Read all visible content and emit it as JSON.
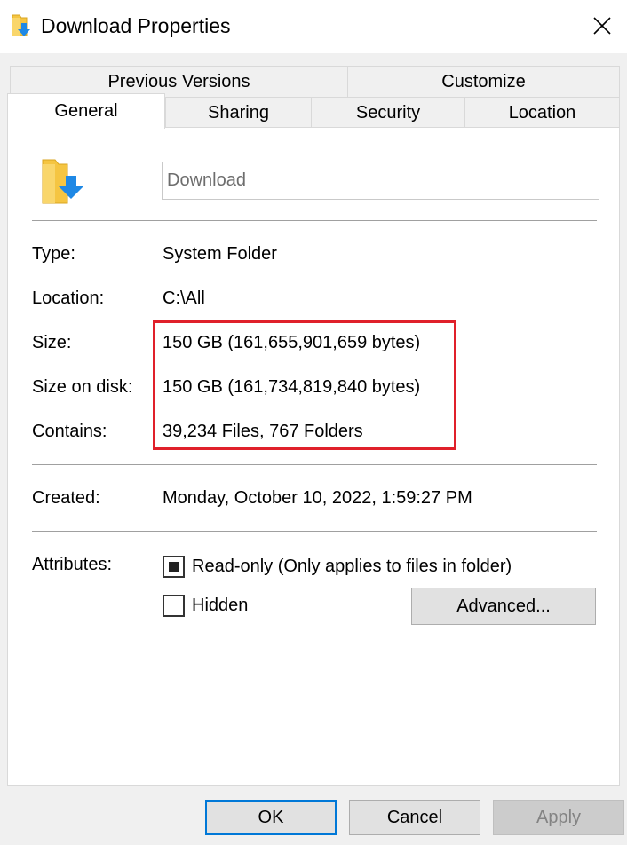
{
  "window": {
    "title": "Download Properties"
  },
  "tabs": {
    "row1": [
      "Previous Versions",
      "Customize"
    ],
    "row2": [
      "General",
      "Sharing",
      "Security",
      "Location"
    ]
  },
  "general": {
    "folder_name": "Download",
    "rows": [
      {
        "label": "Type:",
        "value": "System Folder"
      },
      {
        "label": "Location:",
        "value": "C:\\All"
      },
      {
        "label": "Size:",
        "value": "150 GB (161,655,901,659 bytes)"
      },
      {
        "label": "Size on disk:",
        "value": "150 GB (161,734,819,840 bytes)"
      },
      {
        "label": "Contains:",
        "value": "39,234 Files, 767 Folders"
      }
    ],
    "created": {
      "label": "Created:",
      "value": "Monday, October 10, 2022, 1:59:27 PM"
    },
    "attributes": {
      "label": "Attributes:",
      "readonly": {
        "label": "Read-only (Only applies to files in folder)",
        "state": "indeterminate"
      },
      "hidden": {
        "label": "Hidden",
        "state": "unchecked"
      },
      "advanced_label": "Advanced..."
    }
  },
  "buttons": {
    "ok": "OK",
    "cancel": "Cancel",
    "apply": "Apply"
  },
  "colors": {
    "highlight": "#e0202a",
    "focus_border": "#0078d7",
    "folder": "#f5c542",
    "arrow": "#1e88e5"
  }
}
